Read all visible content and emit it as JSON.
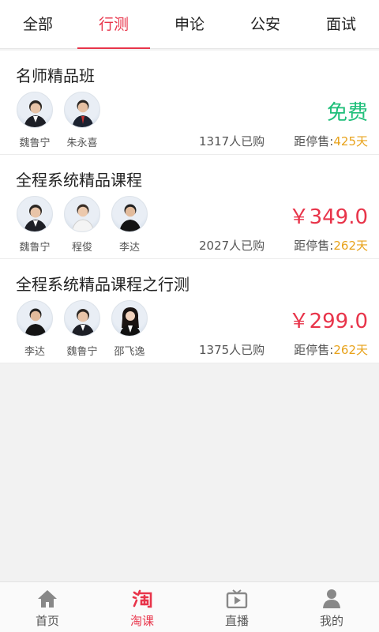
{
  "tabs": [
    {
      "label": "全部",
      "active": false
    },
    {
      "label": "行测",
      "active": true
    },
    {
      "label": "申论",
      "active": false
    },
    {
      "label": "公安",
      "active": false
    },
    {
      "label": "面试",
      "active": false
    }
  ],
  "courses": [
    {
      "title": "名师精品班",
      "teachers": [
        "魏鲁宁",
        "朱永喜"
      ],
      "price": "免费",
      "buyers": "1317人已购",
      "deadline_label": "距停售:",
      "deadline_days": "425天"
    },
    {
      "title": "全程系统精品课程",
      "teachers": [
        "魏鲁宁",
        "程俊",
        "李达"
      ],
      "price": "￥349.0",
      "buyers": "2027人已购",
      "deadline_label": "距停售:",
      "deadline_days": "262天"
    },
    {
      "title": "全程系统精品课程之行测",
      "teachers": [
        "李达",
        "魏鲁宁",
        "邵飞逸"
      ],
      "price": "￥299.0",
      "buyers": "1375人已购",
      "deadline_label": "距停售:",
      "deadline_days": "262天"
    }
  ],
  "bottom_nav": [
    {
      "label": "首页",
      "icon": "home-icon",
      "active": false
    },
    {
      "label": "淘课",
      "icon": "taoke-icon",
      "active": true
    },
    {
      "label": "直播",
      "icon": "live-tv-icon",
      "active": false
    },
    {
      "label": "我的",
      "icon": "user-icon",
      "active": false
    }
  ],
  "colors": {
    "accent": "#e8344a",
    "free": "#1fbf7a",
    "days": "#e8a21a"
  }
}
